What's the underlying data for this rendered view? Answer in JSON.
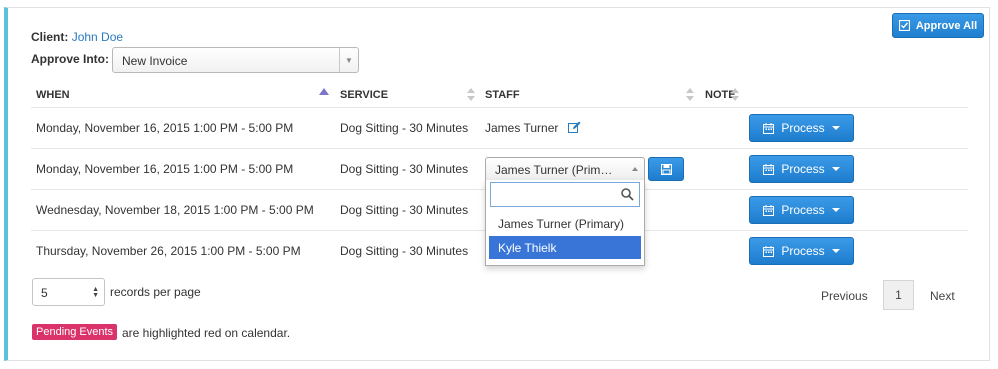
{
  "toolbar": {
    "approve_all_label": "Approve All",
    "approve_all_icon": "check-square-icon"
  },
  "client": {
    "label": "Client:",
    "name": "John Doe"
  },
  "approve_into": {
    "label": "Approve Into:",
    "selected": "New Invoice"
  },
  "table": {
    "columns": [
      "WHEN",
      "SERVICE",
      "STAFF",
      "NOTE"
    ],
    "rows": [
      {
        "when": "Monday, November 16, 2015 1:00 PM - 5:00 PM",
        "service": "Dog Sitting - 30 Minutes",
        "staff": "James Turner",
        "action": "Process"
      },
      {
        "when": "Monday, November 16, 2015 1:00 PM - 5:00 PM",
        "service": "Dog Sitting - 30 Minutes",
        "staff": "James Turner (Primary)",
        "action": "Process"
      },
      {
        "when": "Wednesday, November 18, 2015 1:00 PM - 5:00 PM",
        "service": "Dog Sitting - 30 Minutes",
        "staff": "",
        "action": "Process"
      },
      {
        "when": "Thursday, November 26, 2015 1:00 PM - 5:00 PM",
        "service": "Dog Sitting - 30 Minutes",
        "staff": "",
        "action": "Process"
      }
    ]
  },
  "staff_dropdown": {
    "selected_display": "James Turner (Prim…",
    "search_value": "",
    "options": [
      "James Turner (Primary)",
      "Kyle Thielk"
    ],
    "highlighted_option": "Kyle Thielk"
  },
  "pagination": {
    "per_page_value": "5",
    "per_page_label": "records per page",
    "previous_label": "Previous",
    "current_page": "1",
    "next_label": "Next"
  },
  "legend": {
    "badge_label": "Pending Events",
    "text": "are highlighted red on calendar."
  },
  "colors": {
    "accent": "#5bc0de",
    "primary": "#1e7ccd",
    "link": "#2a7ac0",
    "badge": "#d9336a",
    "highlight": "#3875d7"
  }
}
